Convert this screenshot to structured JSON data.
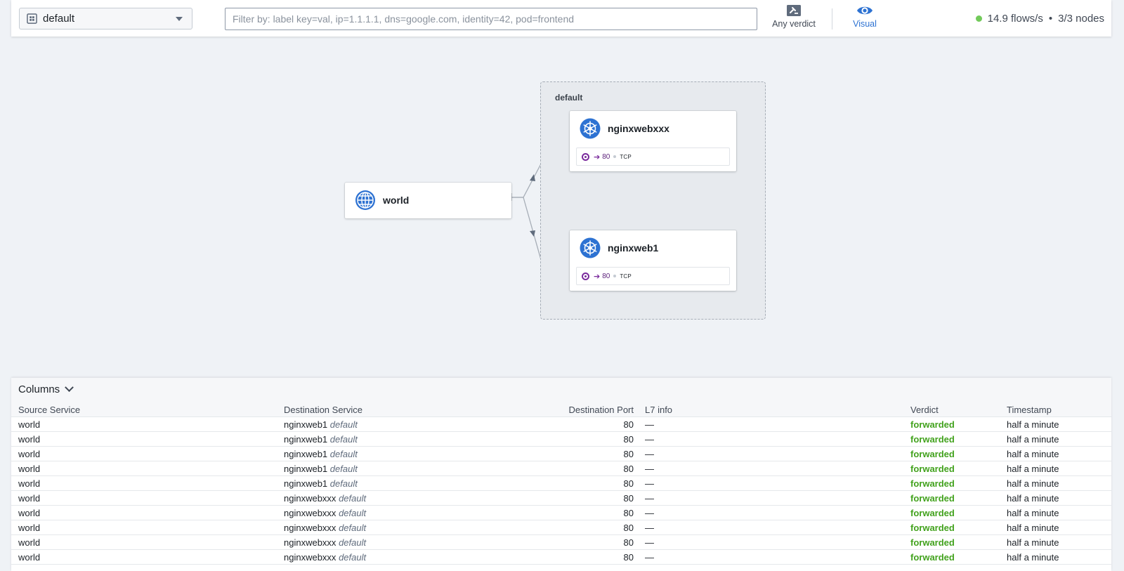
{
  "topbar": {
    "namespace": "default",
    "filter_placeholder": "Filter by: label key=val, ip=1.1.1.1, dns=google.com, identity=42, pod=frontend",
    "verdict_label": "Any verdict",
    "visual_label": "Visual",
    "flows_rate": "14.9 flows/s",
    "separator": "•",
    "nodes": "3/3 nodes",
    "status_color": "#72ca5a"
  },
  "map": {
    "namespace_label": "default",
    "world": {
      "name": "world",
      "icon": "globe-icon"
    },
    "services": [
      {
        "name": "nginxwebxxx",
        "icon": "kubernetes-icon",
        "port": "80",
        "protocol": "TCP"
      },
      {
        "name": "nginxweb1",
        "icon": "kubernetes-icon",
        "port": "80",
        "protocol": "TCP"
      }
    ]
  },
  "flows": {
    "columns_label": "Columns",
    "headers": {
      "source": "Source Service",
      "destination": "Destination Service",
      "port": "Destination Port",
      "l7": "L7 info",
      "verdict": "Verdict",
      "timestamp": "Timestamp"
    },
    "rows": [
      {
        "src": "world",
        "dst": "nginxweb1",
        "dst_ns": "default",
        "port": "80",
        "l7": "—",
        "verdict": "forwarded",
        "time": "half a minute"
      },
      {
        "src": "world",
        "dst": "nginxweb1",
        "dst_ns": "default",
        "port": "80",
        "l7": "—",
        "verdict": "forwarded",
        "time": "half a minute"
      },
      {
        "src": "world",
        "dst": "nginxweb1",
        "dst_ns": "default",
        "port": "80",
        "l7": "—",
        "verdict": "forwarded",
        "time": "half a minute"
      },
      {
        "src": "world",
        "dst": "nginxweb1",
        "dst_ns": "default",
        "port": "80",
        "l7": "—",
        "verdict": "forwarded",
        "time": "half a minute"
      },
      {
        "src": "world",
        "dst": "nginxweb1",
        "dst_ns": "default",
        "port": "80",
        "l7": "—",
        "verdict": "forwarded",
        "time": "half a minute"
      },
      {
        "src": "world",
        "dst": "nginxwebxxx",
        "dst_ns": "default",
        "port": "80",
        "l7": "—",
        "verdict": "forwarded",
        "time": "half a minute"
      },
      {
        "src": "world",
        "dst": "nginxwebxxx",
        "dst_ns": "default",
        "port": "80",
        "l7": "—",
        "verdict": "forwarded",
        "time": "half a minute"
      },
      {
        "src": "world",
        "dst": "nginxwebxxx",
        "dst_ns": "default",
        "port": "80",
        "l7": "—",
        "verdict": "forwarded",
        "time": "half a minute"
      },
      {
        "src": "world",
        "dst": "nginxwebxxx",
        "dst_ns": "default",
        "port": "80",
        "l7": "—",
        "verdict": "forwarded",
        "time": "half a minute"
      },
      {
        "src": "world",
        "dst": "nginxwebxxx",
        "dst_ns": "default",
        "port": "80",
        "l7": "—",
        "verdict": "forwarded",
        "time": "half a minute"
      }
    ]
  }
}
